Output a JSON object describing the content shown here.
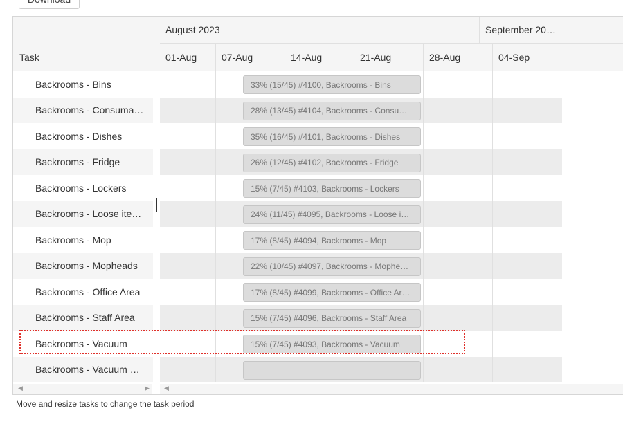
{
  "toolbar": {
    "download_label": "Download"
  },
  "grid": {
    "header_title": "Task"
  },
  "timeline": {
    "months": [
      "August 2023",
      "September 20…"
    ],
    "weeks": [
      "01-Aug",
      "07-Aug",
      "14-Aug",
      "21-Aug",
      "28-Aug",
      "04-Sep"
    ]
  },
  "tasks": [
    {
      "name": "Backrooms - Bins",
      "bar": "33% (15/45) #4100, Backrooms - Bins",
      "progress": 0.33
    },
    {
      "name": "Backrooms - Consuma…",
      "bar": "28% (13/45) #4104, Backrooms - Consu…",
      "progress": 0.28
    },
    {
      "name": "Backrooms - Dishes",
      "bar": "35% (16/45) #4101, Backrooms - Dishes",
      "progress": 0.35
    },
    {
      "name": "Backrooms - Fridge",
      "bar": "26% (12/45) #4102, Backrooms - Fridge",
      "progress": 0.26
    },
    {
      "name": "Backrooms - Lockers",
      "bar": "15% (7/45) #4103, Backrooms - Lockers",
      "progress": 0.15
    },
    {
      "name": "Backrooms - Loose ite…",
      "bar": "24% (11/45) #4095, Backrooms - Loose i…",
      "progress": 0.24
    },
    {
      "name": "Backrooms - Mop",
      "bar": "17% (8/45) #4094, Backrooms - Mop",
      "progress": 0.17
    },
    {
      "name": "Backrooms - Mopheads",
      "bar": "22% (10/45) #4097, Backrooms - Mophe…",
      "progress": 0.22
    },
    {
      "name": "Backrooms - Office Area",
      "bar": "17% (8/45) #4099, Backrooms - Office Ar…",
      "progress": 0.17
    },
    {
      "name": "Backrooms - Staff Area",
      "bar": "15% (7/45) #4096, Backrooms - Staff Area",
      "progress": 0.15
    },
    {
      "name": "Backrooms - Vacuum",
      "bar": "15% (7/45) #4093, Backrooms - Vacuum",
      "progress": 0.15
    },
    {
      "name": "Backrooms - Vacuum …",
      "bar": "",
      "progress": null
    }
  ],
  "footer": {
    "hint": "Move and resize tasks to change the task period"
  },
  "colors": {
    "bar_fill": "#dcdcdc",
    "bar_border": "#c6c6c6",
    "highlight": "#e0312b",
    "alt_row": "#ececec"
  }
}
